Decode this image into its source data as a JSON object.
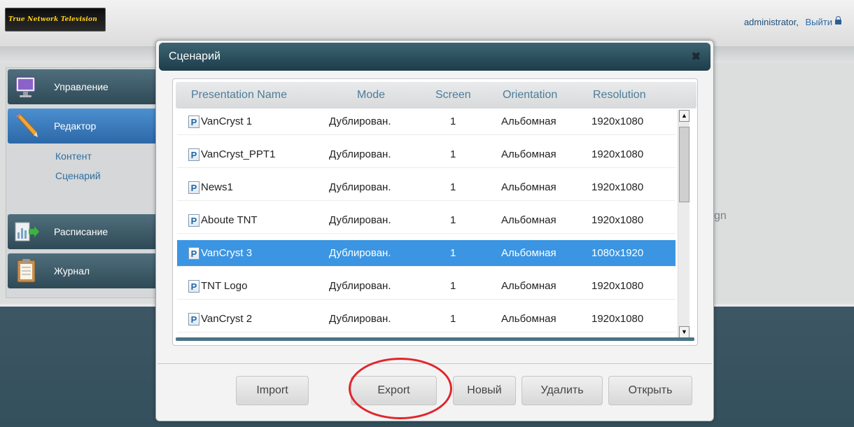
{
  "app": {
    "logo_text": "True Network Television",
    "user": "administrator",
    "user_sep": ",",
    "logout": "Выйти"
  },
  "sidebar": {
    "items": [
      {
        "label": "Управление",
        "icon": "monitor-icon"
      },
      {
        "label": "Редактор",
        "icon": "pencil-icon",
        "active": true
      },
      {
        "label": "Расписание",
        "icon": "chart-arrow-icon"
      },
      {
        "label": "Журнал",
        "icon": "clipboard-icon"
      }
    ],
    "subitems": [
      "Контент",
      "Сценарий"
    ]
  },
  "background_fragment": "gn",
  "modal": {
    "title": "Сценарий",
    "close_glyph": "✖",
    "columns": [
      "Presentation Name",
      "Mode",
      "Screen",
      "Orientation",
      "Resolution"
    ],
    "rows": [
      {
        "name": "VanCryst 1",
        "mode": "Дублирован.",
        "screen": "1",
        "orientation": "Альбомная",
        "resolution": "1920x1080"
      },
      {
        "name": "VanCryst_PPT1",
        "mode": "Дублирован.",
        "screen": "1",
        "orientation": "Альбомная",
        "resolution": "1920x1080"
      },
      {
        "name": "News1",
        "mode": "Дублирован.",
        "screen": "1",
        "orientation": "Альбомная",
        "resolution": "1920x1080"
      },
      {
        "name": "Aboute TNT",
        "mode": "Дублирован.",
        "screen": "1",
        "orientation": "Альбомная",
        "resolution": "1920x1080"
      },
      {
        "name": "VanCryst 3",
        "mode": "Дублирован.",
        "screen": "1",
        "orientation": "Альбомная",
        "resolution": "1080x1920",
        "selected": true
      },
      {
        "name": "TNT Logo",
        "mode": "Дублирован.",
        "screen": "1",
        "orientation": "Альбомная",
        "resolution": "1920x1080"
      },
      {
        "name": "VanCryst 2",
        "mode": "Дублирован.",
        "screen": "1",
        "orientation": "Альбомная",
        "resolution": "1920x1080"
      }
    ],
    "row_icon_glyph": "P",
    "buttons": {
      "import": "Import",
      "export": "Export",
      "new": "Новый",
      "delete": "Удалить",
      "open": "Открыть"
    }
  },
  "colors": {
    "header_teal": "#2a4d5c",
    "selected_row": "#3b95e2",
    "active_nav": "#3a7fc4",
    "highlight_ring": "#e0262c"
  }
}
